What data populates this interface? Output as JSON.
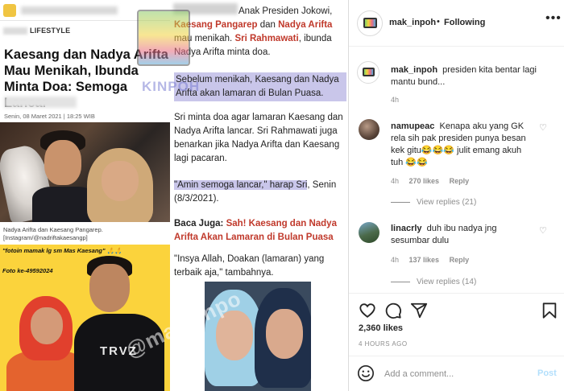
{
  "article": {
    "section": "LIFESTYLE",
    "headline": "Kaesang dan Nadya Arifta Mau Menikah, Ibunda Minta Doa: Semoga Lancar",
    "date": "Senin, 08 Maret 2021 | 18:25 WIB",
    "photo_caption": "Nadya Arifta dan Kaesang Pangarep. [Instagram/@nadriftakaesangp]",
    "photo2_text": "\"fotoin mamak lg sm Mas Kaesang\" 🙏🙏",
    "photo2_count": "Foto ke-49592024",
    "shirt_text": "TRVZ",
    "p1_pre": "Anak Presiden Jokowi, ",
    "p1_name1": "Kaesang Pangarep",
    "p1_mid1": " dan ",
    "p1_name2": "Nadya Arifta",
    "p1_mid2": " mau menikah. ",
    "p1_name3": "Sri Rahmawati",
    "p1_post": ", ibunda Nadya Arifta minta doa.",
    "p2": "Sebelum menikah, Kaesang dan Nadya Arifta akan lamaran di Bulan Puasa.",
    "p3": "Sri minta doa agar lamaran Kaesang dan Nadya Arifta lancar. Sri Rahmawati juga benarkan jika Nadya Arifta dan Kaesang lagi pacaran.",
    "p4_quote": "\"Amin semoga lancar,\" harap Sri",
    "p4_post": ", Senin (8/3/2021).",
    "baca_label": "Baca Juga: ",
    "baca_link": "Sah! Kaesang dan Nadya Arifta Akan Lamaran di Bulan Puasa",
    "p6": "\"Insya Allah, Doakan (lamaran) yang terbaik aja,\" tambahnya.",
    "watermark_text": "KINPOH",
    "watermark_diag": "@mak_inpo"
  },
  "instagram": {
    "username": "mak_inpoh",
    "separator": "•",
    "follow_status": "Following",
    "more": "•••",
    "caption": {
      "user": "mak_inpoh",
      "text": "presiden kita bentar lagi mantu bund...",
      "time": "4h"
    },
    "comments": [
      {
        "user": "namupeac",
        "text": "Kenapa aku yang GK rela sih pak presiden punya besan kek gitu😂😂😂 julit emang akuh tuh 😂😂",
        "time": "4h",
        "likes": "270 likes",
        "reply": "Reply",
        "view_replies": "View replies (21)"
      },
      {
        "user": "linacrly",
        "text": "duh ibu nadya jng sesumbar dulu",
        "time": "4h",
        "likes": "137 likes",
        "reply": "Reply",
        "view_replies": "View replies (14)"
      }
    ],
    "likes": "2,360 likes",
    "post_time": "4 HOURS AGO",
    "comment_placeholder": "Add a comment...",
    "post_button": "Post",
    "colors": {
      "link_blue": "#b2dffc",
      "meta_gray": "#8e8e8e",
      "text": "#262626"
    },
    "icons": [
      "heart-icon",
      "comment-icon",
      "share-icon",
      "bookmark-icon",
      "emoji-icon",
      "more-icon"
    ]
  }
}
